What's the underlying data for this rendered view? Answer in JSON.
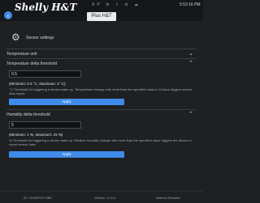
{
  "header": {
    "logo": "Shelly H&T",
    "device_title": "Plus H&T",
    "status_icons": "AP ⚙ ⇩ ⊘ ☁",
    "time": "5:52:16 PM"
  },
  "settings": {
    "title": "Sensor settings"
  },
  "temperature_unit": {
    "label": "Temperature unit"
  },
  "temperature_threshold": {
    "label": "Temperature delta threshold",
    "value": "0.5",
    "limits": "(Minimum: 0.5 °C, Maximum: 5 °C)",
    "help": "°C Threshold for triggering a device wake up. Temperature change with more than the specified value in Celsius triggers sensor data report.",
    "apply_label": "Apply"
  },
  "humidity_threshold": {
    "label": "Humidity delta threshold",
    "value": "5",
    "limits": "(Minimum: 1 %, Maximum: 25 %)",
    "help": "% Threshold for triggering a device wake up. Relative humidity change with more than the specified value triggers the device to report sensor data.",
    "apply_label": "Apply"
  },
  "footer": {
    "id": "ID: C049EF8774BC",
    "version": "Version: 0.11.0",
    "brand": "Allterco Robotics"
  }
}
